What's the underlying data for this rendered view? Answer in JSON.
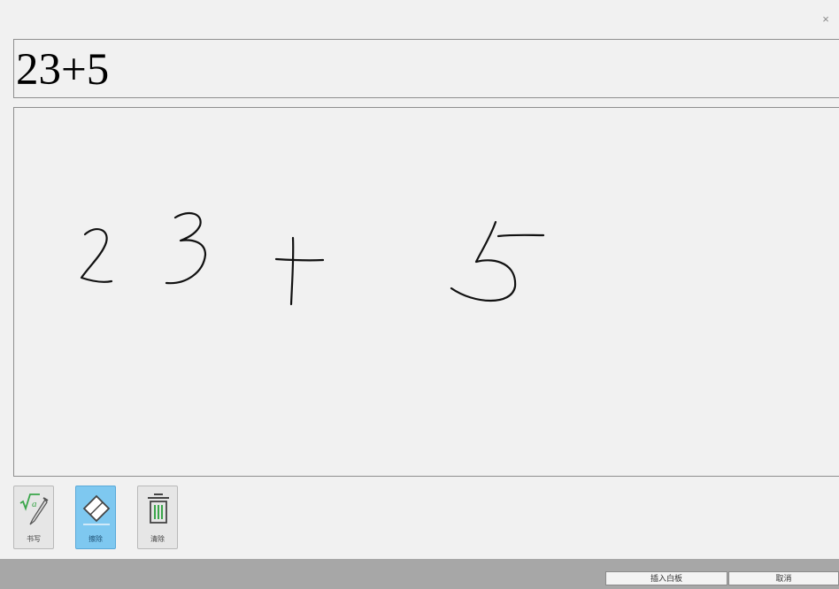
{
  "dialog": {
    "close_glyph": "×"
  },
  "preview": {
    "text": "23+5"
  },
  "handwriting": {
    "strokes_note": "2 3 + 5"
  },
  "tools": [
    {
      "id": "write",
      "label": "书写",
      "icon": "math-pen-icon",
      "active": false
    },
    {
      "id": "erase",
      "label": "擦除",
      "icon": "eraser-icon",
      "active": true
    },
    {
      "id": "clear",
      "label": "清除",
      "icon": "trash-icon",
      "active": false
    }
  ],
  "footer": {
    "insert_label": "插入白板",
    "cancel_label": "取消"
  },
  "colors": {
    "background": "#f1f1f1",
    "active_tool": "#7ec8f0",
    "footer": "#a7a7a7",
    "icon_green": "#3aa64a"
  }
}
